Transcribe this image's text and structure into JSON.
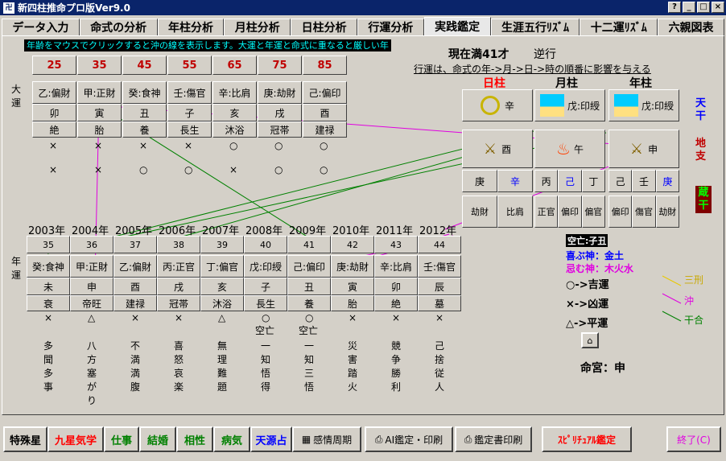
{
  "title": "新四柱推命プロ版Ver9.0",
  "window_buttons": [
    "?",
    "_",
    "□",
    "×"
  ],
  "tabs": [
    "データ入力",
    "命式の分析",
    "年柱分析",
    "月柱分析",
    "日柱分析",
    "行運分析",
    "実践鑑定",
    "生涯五行ﾘｽﾞﾑ",
    "十二運ﾘｽﾞﾑ",
    "六親図表"
  ],
  "hint": "年齢をマウスでクリックすると沖の線を表示します。大運と年運と命式に重なると厳しい年",
  "current_age": "現在満41才",
  "direction": "逆行",
  "order_note": "行運は、命式の年->月->日->時の順番に影響を与える",
  "daiun_label": "大運",
  "nenun_label": "年運",
  "daiun": {
    "ages": [
      "25",
      "35",
      "45",
      "55",
      "65",
      "75",
      "85"
    ],
    "kan": [
      "乙:偏財",
      "甲:正財",
      "癸:食神",
      "壬:傷官",
      "辛:比肩",
      "庚:劫財",
      "己:偏印"
    ],
    "shi": [
      "卯",
      "寅",
      "丑",
      "子",
      "亥",
      "戌",
      "酉"
    ],
    "unsei": [
      "絶",
      "胎",
      "養",
      "長生",
      "沐浴",
      "冠帯",
      "建禄"
    ],
    "mark1": [
      "×",
      "×",
      "×",
      "×",
      "○",
      "○",
      "○"
    ],
    "mark2": [
      "×",
      "×",
      "○",
      "○",
      "×",
      "○",
      "○"
    ]
  },
  "nenun": {
    "years": [
      "2003年",
      "2004年",
      "2005年",
      "2006年",
      "2007年",
      "2008年",
      "2009年",
      "2010年",
      "2011年",
      "2012年"
    ],
    "ages": [
      "35",
      "36",
      "37",
      "38",
      "39",
      "40",
      "41",
      "42",
      "43",
      "44"
    ],
    "kan": [
      "癸:食神",
      "甲:正財",
      "乙:偏財",
      "丙:正官",
      "丁:偏官",
      "戊:印綬",
      "己:偏印",
      "庚:劫財",
      "辛:比肩",
      "壬:傷官"
    ],
    "shi": [
      "未",
      "申",
      "酉",
      "戌",
      "亥",
      "子",
      "丑",
      "寅",
      "卯",
      "辰"
    ],
    "unsei": [
      "衰",
      "帝旺",
      "建禄",
      "冠帯",
      "沐浴",
      "長生",
      "養",
      "胎",
      "絶",
      "墓"
    ],
    "mark": [
      "×",
      "△",
      "×",
      "×",
      "△",
      "○",
      "○",
      "×",
      "×",
      "×"
    ],
    "kubou": [
      "",
      "",
      "",
      "",
      "",
      "空亡",
      "空亡",
      "",
      "",
      ""
    ],
    "desc": [
      "多聞多事",
      "八方塞がり",
      "不満満腹",
      "喜怒哀楽",
      "無理難題",
      "一知悟得",
      "一知三悟",
      "災害踏火",
      "競争勝利",
      "己捨従人"
    ]
  },
  "pillars": {
    "headers": [
      "日柱",
      "月柱",
      "年柱"
    ],
    "kan": [
      "辛",
      "戊:印綬",
      "戊:印綬"
    ],
    "shi": [
      "酉",
      "午",
      "申"
    ],
    "zokan": [
      [
        "庚",
        "辛"
      ],
      [
        "丙",
        "己",
        "丁"
      ],
      [
        "己",
        "壬",
        "庚"
      ]
    ],
    "zokan_tsu": [
      [
        "劫財",
        "比肩"
      ],
      [
        "正官",
        "偏印",
        "偏官"
      ],
      [
        "偏印",
        "傷官",
        "劫財"
      ]
    ]
  },
  "side_labels": {
    "tenkan": "天干",
    "chishi": "地支",
    "zokan": "蔵干"
  },
  "kubou_title": "空亡:子丑",
  "yorokobu": "喜ぶ神：金土",
  "imu": "忌む神：木火水",
  "legend": [
    {
      "sym": "○->吉運"
    },
    {
      "sym": "×->凶運"
    },
    {
      "sym": "△->平運"
    }
  ],
  "line_legend": [
    {
      "name": "三刑",
      "color": "#ffd400"
    },
    {
      "name": "沖",
      "color": "#e000e0"
    },
    {
      "name": "干合",
      "color": "#008000"
    }
  ],
  "meikyu": "命宮：申",
  "bottom_buttons": [
    "特殊星",
    "九星気学",
    "仕事",
    "結婚",
    "相性",
    "病気",
    "天源占",
    "感情周期",
    "AI鑑定・印刷",
    "鑑定書印刷",
    "ｽﾋﾟﾘﾁｭｱﾙ鑑定",
    "終了(C)"
  ],
  "colors": {
    "title_bar": "#0a246a",
    "hint_text": "#00ffff",
    "red": "#ff0000",
    "blue": "#0000ff",
    "magenta": "#e000e0",
    "green": "#008000"
  }
}
